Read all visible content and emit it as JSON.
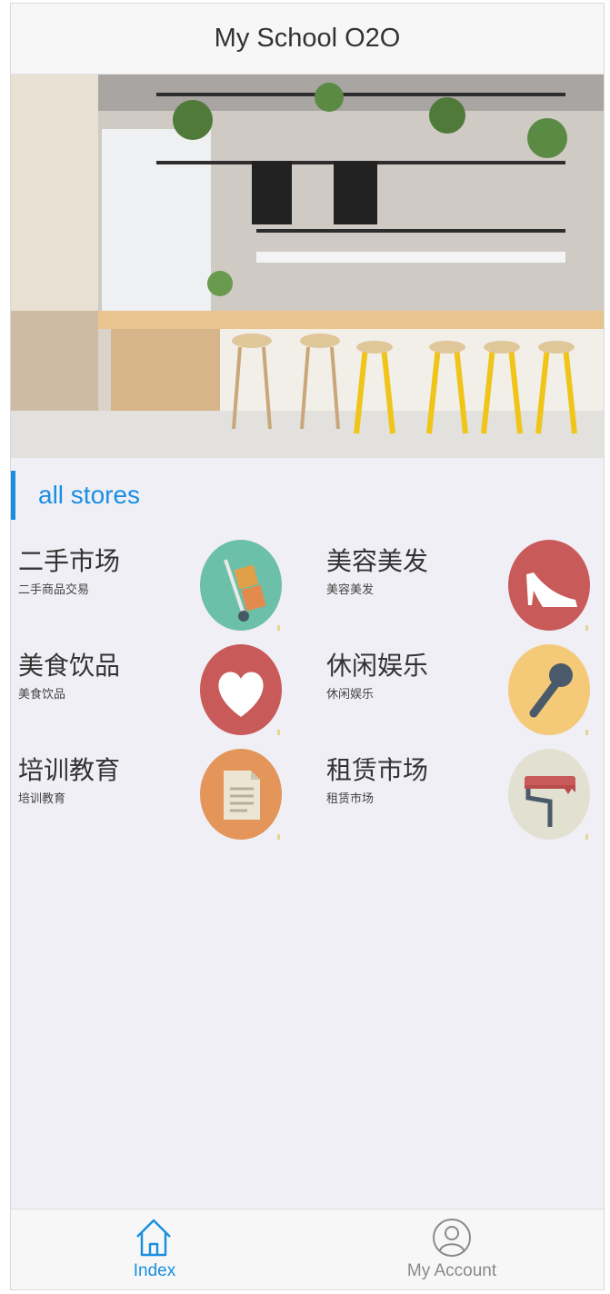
{
  "header": {
    "title": "My School O2O"
  },
  "carousel": {
    "slide_count": 4,
    "active_index": 3
  },
  "section": {
    "title": "all stores"
  },
  "categories": [
    {
      "name": "二手市场",
      "sub": "二手商品交易",
      "icon": "hand-truck-icon",
      "color": "#6cbfa9"
    },
    {
      "name": "美容美发",
      "sub": "美容美发",
      "icon": "high-heel-icon",
      "color": "#c85a5a"
    },
    {
      "name": "美食饮品",
      "sub": "美食饮品",
      "icon": "heart-icon",
      "color": "#c85a5a"
    },
    {
      "name": "休闲娱乐",
      "sub": "休闲娱乐",
      "icon": "microphone-icon",
      "color": "#f4c978"
    },
    {
      "name": "培训教育",
      "sub": "培训教育",
      "icon": "document-icon",
      "color": "#e4955a"
    },
    {
      "name": "租赁市场",
      "sub": "租赁市场",
      "icon": "paint-roller-icon",
      "color": "#e2e0d0"
    }
  ],
  "tabbar": {
    "index_label": "Index",
    "account_label": "My Account",
    "active_color": "#1a8fe0",
    "inactive_color": "#8a8a8a"
  }
}
